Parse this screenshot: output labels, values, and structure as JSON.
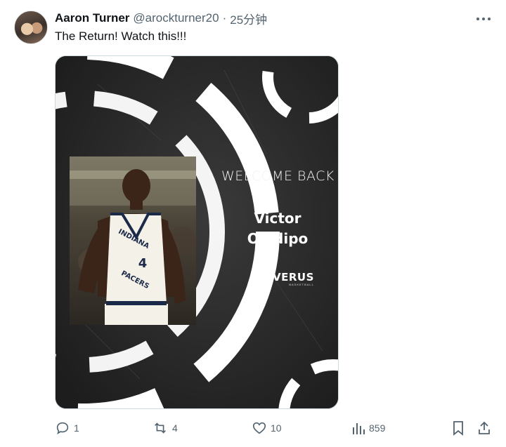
{
  "author": {
    "name": "Aaron Turner",
    "handle": "@arockturner20",
    "separator": "·",
    "time": "25分钟"
  },
  "tweet": {
    "text": "The Return! Watch this!!!"
  },
  "media": {
    "headline": "WELCOME BACK",
    "first_name": "Victor",
    "last_name": "Oladipo",
    "logo_text": "VERUS",
    "logo_subtext": "BASKETBALL",
    "jersey_text": "INDIANA PACERS",
    "jersey_number": "4",
    "colors": {
      "background": "#222222",
      "ring": "#ffffff",
      "jersey": "#f4f1e8",
      "jersey_trim": "#1c2a4a"
    }
  },
  "actions": {
    "reply_count": "1",
    "retweet_count": "4",
    "like_count": "10",
    "view_count": "859"
  },
  "icons": [
    "more-icon",
    "reply-icon",
    "retweet-icon",
    "like-icon",
    "views-icon",
    "bookmark-icon",
    "share-icon"
  ]
}
